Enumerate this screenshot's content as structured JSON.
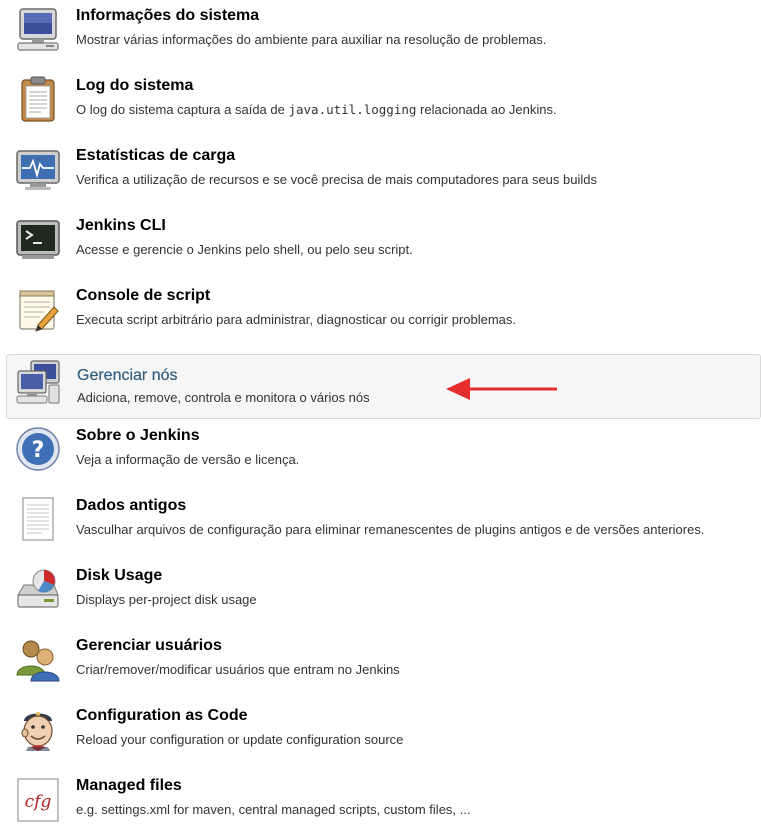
{
  "items": [
    {
      "title": "Informações do sistema",
      "desc": "Mostrar várias informações do ambiente para auxiliar na resolução de problemas.",
      "icon": "computer-icon"
    },
    {
      "title": "Log do sistema",
      "desc_pre": "O log do sistema captura a saída de ",
      "desc_code": "java.util.logging",
      "desc_post": " relacionada ao Jenkins.",
      "icon": "clipboard-icon"
    },
    {
      "title": "Estatísticas de carga",
      "desc": "Verifica a utilização de recursos e se você precisa de mais computadores para seus builds",
      "icon": "monitor-graph-icon"
    },
    {
      "title": "Jenkins CLI",
      "desc": "Acesse e gerencie o Jenkins pelo shell, ou pelo seu script.",
      "icon": "terminal-icon"
    },
    {
      "title": "Console de script",
      "desc": "Executa script arbitrário para administrar, diagnosticar ou corrigir problemas.",
      "icon": "notepad-icon"
    },
    {
      "title": "Gerenciar nós",
      "desc": "Adiciona, remove, controla e monitora o vários nós",
      "icon": "computers-icon"
    },
    {
      "title": "Sobre o Jenkins",
      "desc": "Veja a informação de versão e licença.",
      "icon": "help-icon"
    },
    {
      "title": "Dados antigos",
      "desc": "Vasculhar arquivos de configuração para eliminar remanescentes de plugins antigos e de versões anteriores.",
      "icon": "document-icon"
    },
    {
      "title": "Disk Usage",
      "desc": "Displays per-project disk usage",
      "icon": "disk-usage-icon"
    },
    {
      "title": "Gerenciar usuários",
      "desc": "Criar/remover/modificar usuários que entram no Jenkins",
      "icon": "users-icon"
    },
    {
      "title": "Configuration as Code",
      "desc": "Reload your configuration or update configuration source",
      "icon": "jenkins-butler-icon"
    },
    {
      "title": "Managed files",
      "desc": "e.g. settings.xml for maven, central managed scripts, custom files, ...",
      "icon": "cfg-file-icon"
    }
  ],
  "icon_text": {
    "cfg": "cfg"
  },
  "colors": {
    "highlight_title": "#335d7e",
    "arrow": "#e62e2e",
    "highlight_bg": "#f6f6f6"
  }
}
